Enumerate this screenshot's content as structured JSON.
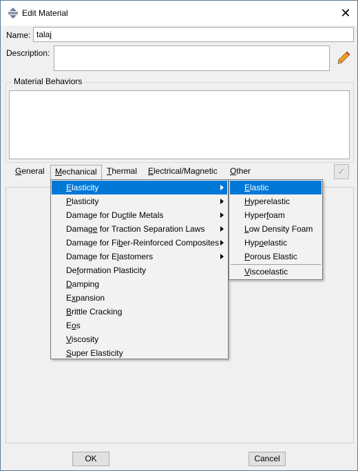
{
  "window": {
    "title": "Edit Material",
    "close_glyph": "✕"
  },
  "form": {
    "name_label": "Name:",
    "name_value": "talaj",
    "description_label": "Description:",
    "description_value": ""
  },
  "behaviors": {
    "title": "Material Behaviors",
    "items": []
  },
  "menubar": [
    {
      "label": "General",
      "accel": "G",
      "rest": "eneral"
    },
    {
      "label": "Mechanical",
      "accel": "M",
      "rest": "echanical"
    },
    {
      "label": "Thermal",
      "accel": "T",
      "rest": "hermal"
    },
    {
      "label": "Electrical/Magnetic",
      "accel": "E",
      "rest": "lectrical/Magnetic"
    },
    {
      "label": "Other",
      "accel": "O",
      "rest": "ther"
    }
  ],
  "mechanical_menu": [
    {
      "pre": "",
      "accel": "E",
      "post": "lasticity",
      "submenu": true,
      "selected": true
    },
    {
      "pre": "",
      "accel": "P",
      "post": "lasticity",
      "submenu": true
    },
    {
      "pre": "Damage for Du",
      "accel": "c",
      "post": "tile Metals",
      "submenu": true
    },
    {
      "pre": "Damag",
      "accel": "e",
      "post": " for Traction Separation Laws",
      "submenu": true
    },
    {
      "pre": "Damage for Fi",
      "accel": "b",
      "post": "er-Reinforced Composites",
      "submenu": true
    },
    {
      "pre": "Damage for E",
      "accel": "l",
      "post": "astomers",
      "submenu": true
    },
    {
      "pre": "De",
      "accel": "f",
      "post": "ormation Plasticity",
      "submenu": false
    },
    {
      "pre": "",
      "accel": "D",
      "post": "amping",
      "submenu": false
    },
    {
      "pre": "E",
      "accel": "x",
      "post": "pansion",
      "submenu": false
    },
    {
      "pre": "",
      "accel": "B",
      "post": "rittle Cracking",
      "submenu": false
    },
    {
      "pre": "E",
      "accel": "o",
      "post": "s",
      "submenu": false
    },
    {
      "pre": "",
      "accel": "V",
      "post": "iscosity",
      "submenu": false
    },
    {
      "pre": "",
      "accel": "S",
      "post": "uper Elasticity",
      "submenu": false
    }
  ],
  "elasticity_submenu": [
    {
      "pre": "",
      "accel": "E",
      "post": "lastic",
      "selected": true
    },
    {
      "pre": "",
      "accel": "H",
      "post": "yperelastic"
    },
    {
      "pre": "Hyper",
      "accel": "f",
      "post": "oam"
    },
    {
      "pre": "",
      "accel": "L",
      "post": "ow Density Foam"
    },
    {
      "pre": "Hyp",
      "accel": "o",
      "post": "elastic"
    },
    {
      "pre": "",
      "accel": "P",
      "post": "orous Elastic"
    },
    {
      "pre": "",
      "accel": "V",
      "post": "iscoelastic",
      "after_separator": true
    }
  ],
  "buttons": {
    "ok": "OK",
    "cancel": "Cancel"
  },
  "colors": {
    "selection": "#0078d7",
    "window_bg": "#f0f0f0"
  }
}
